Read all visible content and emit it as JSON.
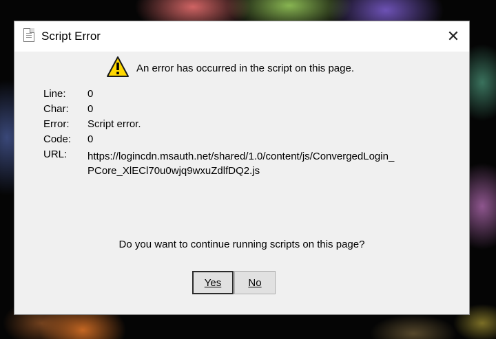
{
  "dialog": {
    "title": "Script Error",
    "close_glyph": "✕",
    "headline": "An error has occurred in the script on this page.",
    "fields": [
      {
        "label": "Line:",
        "value": "0"
      },
      {
        "label": "Char:",
        "value": "0"
      },
      {
        "label": "Error:",
        "value": "Script error."
      },
      {
        "label": "Code:",
        "value": "0"
      },
      {
        "label": "URL:",
        "value": "https://logincdn.msauth.net/shared/1.0/content/js/ConvergedLogin_PCore_XlECl70u0wjq9wxuZdlfDQ2.js"
      }
    ],
    "question": "Do you want to continue running scripts on this page?",
    "yes_label": "Yes",
    "no_label": "No"
  },
  "icons": {
    "title": "script-document-icon",
    "warning": "warning-icon",
    "close": "close-icon"
  },
  "colors": {
    "warning_fill": "#ffd800",
    "dialog_bg": "#f0f0f0",
    "titlebar_bg": "#ffffff"
  }
}
